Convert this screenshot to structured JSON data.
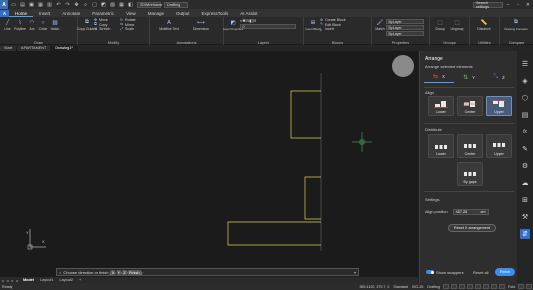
{
  "qat": {
    "logo": "A",
    "workspace": "2DWireframe",
    "drafting": "Drafting",
    "search": "Search settings"
  },
  "ribbon_tabs": [
    "Home",
    "Insert",
    "Annotate",
    "Parametric",
    "View",
    "Manage",
    "Output",
    "ExpressTools",
    "AI Assist"
  ],
  "ribbon": {
    "draw": {
      "title": "Draw",
      "tools": [
        "Line",
        "Polyline",
        "Arc",
        "Circle",
        "Hatch"
      ]
    },
    "modify": {
      "title": "Modify",
      "tools": [
        "Copy Guided",
        "Move",
        "Copy",
        "Stretch",
        "Rotate",
        "Mirror",
        "Scale"
      ]
    },
    "annotations": {
      "title": "Annotations",
      "tools": [
        "Multiline Text",
        "Dimension"
      ]
    },
    "layers": {
      "title": "Layers",
      "layer_value": "0",
      "tools": [
        "Layer Properties"
      ]
    },
    "blocks": {
      "title": "Blocks",
      "tools": [
        "Insert Block",
        "Create Block",
        "Edit Block",
        "Insert"
      ]
    },
    "properties": {
      "title": "Properties",
      "tools": [
        "Match"
      ],
      "values": [
        "ByLayer",
        "ByLayer",
        "ByLayer"
      ]
    },
    "groups": {
      "title": "Groups",
      "tools": [
        "Group",
        "Ungroup"
      ]
    },
    "utilities": {
      "title": "Utilities",
      "tools": [
        "Distance"
      ]
    },
    "compare": {
      "title": "Compare",
      "tools": [
        "Drawing Compare"
      ]
    }
  },
  "file_tabs": [
    "Start",
    "APARTAMENT",
    "Drawing1*"
  ],
  "canvas": {
    "ucs_y": "Y",
    "ucs_x": "X"
  },
  "command_line": {
    "close": "×",
    "prompt": "Choose direction or finish [",
    "options": [
      "X",
      "Y",
      "Z",
      "Finish"
    ],
    "suffix": "]:"
  },
  "layout_tabs": [
    "Model",
    "Layout1",
    "Layout2"
  ],
  "status_bar": {
    "left": "Ready",
    "coords": "359.4120, 379.7, 0",
    "items": [
      "Standard",
      "ISO-25",
      "Drafting",
      "Fold"
    ]
  },
  "arrange_panel": {
    "title": "Arrange",
    "subtitle": "Arrange selected elements",
    "axes": [
      "X",
      "Y",
      "Z"
    ],
    "align_title": "Align",
    "align_options": [
      "Lower",
      "Center",
      "Upper"
    ],
    "distribute_title": "Distribute",
    "distribute_options": [
      "Lower",
      "Center",
      "Upper"
    ],
    "by_gaps": "By gaps",
    "settings_title": "Settings",
    "align_position_label": "Align position",
    "align_position_value": "457.28",
    "align_position_unit": "cm",
    "reset_button": "Reset X arrangement",
    "show_snappers": "Show snappers",
    "reset_all": "Reset all",
    "finish": "Finish"
  },
  "right_dock": [
    "properties-icon",
    "layers-icon",
    "blocks-icon",
    "library-icon",
    "fx-icon",
    "pencil-icon",
    "settings-icon",
    "cloud-icon",
    "attach-icon",
    "tool-icon",
    "arrange-icon"
  ]
}
